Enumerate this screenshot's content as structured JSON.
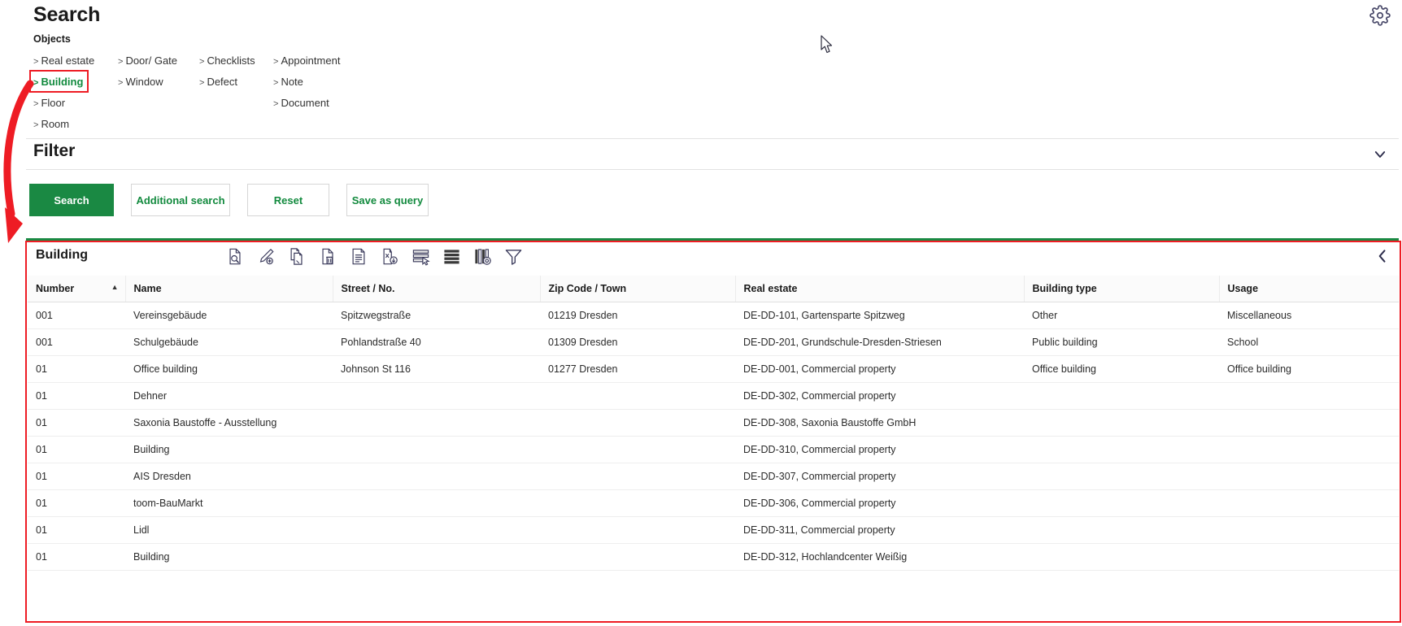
{
  "header": {
    "title": "Search",
    "gear_icon": "gear-icon"
  },
  "objects": {
    "section_label": "Objects",
    "columns": [
      {
        "items": [
          {
            "label": "Real estate",
            "active": false
          },
          {
            "label": "Building",
            "active": true
          },
          {
            "label": "Floor",
            "active": false
          },
          {
            "label": "Room",
            "active": false
          }
        ]
      },
      {
        "items": [
          {
            "label": "Door/ Gate",
            "active": false
          },
          {
            "label": "Window",
            "active": false
          }
        ]
      },
      {
        "items": [
          {
            "label": "Checklists",
            "active": false
          },
          {
            "label": "Defect",
            "active": false
          }
        ]
      },
      {
        "items": [
          {
            "label": "Appointment",
            "active": false
          },
          {
            "label": "Note",
            "active": false
          },
          {
            "label": "Document",
            "active": false
          }
        ]
      }
    ]
  },
  "filter": {
    "title": "Filter",
    "collapse_icon": "chevron-down-icon"
  },
  "actions": {
    "search": "Search",
    "additional_search": "Additional search",
    "reset": "Reset",
    "save_as_query": "Save as query"
  },
  "panel": {
    "title": "Building",
    "collapse_icon": "chevron-left-icon",
    "toolbar": [
      {
        "name": "document-search-icon",
        "title": "Show"
      },
      {
        "name": "edit-pencil-icon",
        "title": "Edit"
      },
      {
        "name": "copy-document-icon",
        "title": "Copy"
      },
      {
        "name": "delete-document-icon",
        "title": "Delete"
      },
      {
        "name": "report-document-icon",
        "title": "Report"
      },
      {
        "name": "export-excel-icon",
        "title": "Export"
      },
      {
        "name": "select-rows-icon",
        "title": "Select"
      },
      {
        "name": "list-view-icon",
        "title": "List view"
      },
      {
        "name": "column-settings-icon",
        "title": "Columns"
      },
      {
        "name": "filter-funnel-icon",
        "title": "Filter"
      }
    ]
  },
  "table": {
    "sort_column": "Number",
    "sort_direction": "asc",
    "columns": [
      "Number",
      "Name",
      "Street / No.",
      "Zip Code / Town",
      "Real estate",
      "Building type",
      "Usage"
    ],
    "rows": [
      {
        "number": "001",
        "name": "Vereinsgebäude",
        "street": "Spitzwegstraße",
        "zip": "01219 Dresden",
        "real_estate": "DE-DD-101, Gartensparte Spitzweg",
        "building_type": "Other",
        "usage": "Miscellaneous"
      },
      {
        "number": "001",
        "name": "Schulgebäude",
        "street": "Pohlandstraße 40",
        "zip": "01309 Dresden",
        "real_estate": "DE-DD-201, Grundschule-Dresden-Striesen",
        "building_type": "Public building",
        "usage": "School"
      },
      {
        "number": "01",
        "name": "Office building",
        "street": "Johnson St 116",
        "zip": "01277 Dresden",
        "real_estate": "DE-DD-001, Commercial property",
        "building_type": "Office building",
        "usage": "Office building"
      },
      {
        "number": "01",
        "name": "Dehner",
        "street": "",
        "zip": "",
        "real_estate": "DE-DD-302, Commercial property",
        "building_type": "",
        "usage": ""
      },
      {
        "number": "01",
        "name": "Saxonia Baustoffe - Ausstellung",
        "street": "",
        "zip": "",
        "real_estate": "DE-DD-308, Saxonia Baustoffe GmbH",
        "building_type": "",
        "usage": ""
      },
      {
        "number": "01",
        "name": "Building",
        "street": "",
        "zip": "",
        "real_estate": "DE-DD-310, Commercial property",
        "building_type": "",
        "usage": ""
      },
      {
        "number": "01",
        "name": "AIS Dresden",
        "street": "",
        "zip": "",
        "real_estate": "DE-DD-307, Commercial property",
        "building_type": "",
        "usage": ""
      },
      {
        "number": "01",
        "name": "toom-BauMarkt",
        "street": "",
        "zip": "",
        "real_estate": "DE-DD-306, Commercial property",
        "building_type": "",
        "usage": ""
      },
      {
        "number": "01",
        "name": "Lidl",
        "street": "",
        "zip": "",
        "real_estate": "DE-DD-311, Commercial property",
        "building_type": "",
        "usage": ""
      },
      {
        "number": "01",
        "name": "Building",
        "street": "",
        "zip": "",
        "real_estate": "DE-DD-312, Hochlandcenter Weißig",
        "building_type": "",
        "usage": ""
      }
    ]
  },
  "annotations": {
    "highlight_box_color": "#ee1c24",
    "arrow_color": "#ee1c24",
    "accent_green": "#1a8943"
  }
}
